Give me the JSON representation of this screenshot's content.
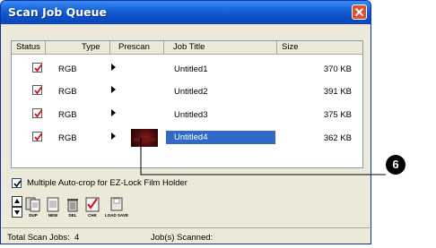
{
  "window": {
    "title": "Scan Job Queue"
  },
  "list": {
    "columns": [
      "Status",
      "Type",
      "Prescan",
      "Job Title",
      "Size"
    ],
    "rows": [
      {
        "type": "RGB",
        "title": "Untitled1",
        "size": "370 KB",
        "checked": true,
        "has_prescan": false,
        "selected": false
      },
      {
        "type": "RGB",
        "title": "Untitled2",
        "size": "391 KB",
        "checked": true,
        "has_prescan": false,
        "selected": false
      },
      {
        "type": "RGB",
        "title": "Untitled3",
        "size": "375 KB",
        "checked": true,
        "has_prescan": false,
        "selected": false
      },
      {
        "type": "RGB",
        "title": "Untitled4",
        "size": "362 KB",
        "checked": true,
        "has_prescan": true,
        "selected": true
      }
    ]
  },
  "option": {
    "label": "Multiple Auto-crop for EZ-Lock Film Holder",
    "checked": true
  },
  "toolbar": {
    "buttons": [
      {
        "label": ""
      },
      {
        "label": "DUP"
      },
      {
        "label": "NEW"
      },
      {
        "label": "DEL"
      },
      {
        "label": "CHK"
      },
      {
        "label": "LOAD SAVE"
      }
    ]
  },
  "status": {
    "total_label": "Total Scan Jobs:",
    "total_value": "4",
    "scanned_label": "Job(s) Scanned:"
  },
  "callout": {
    "number": "6"
  },
  "colors": {
    "title_bar": "#1762d8",
    "selection": "#316ac5",
    "check": "#d0131a",
    "close": "#e0502b"
  }
}
